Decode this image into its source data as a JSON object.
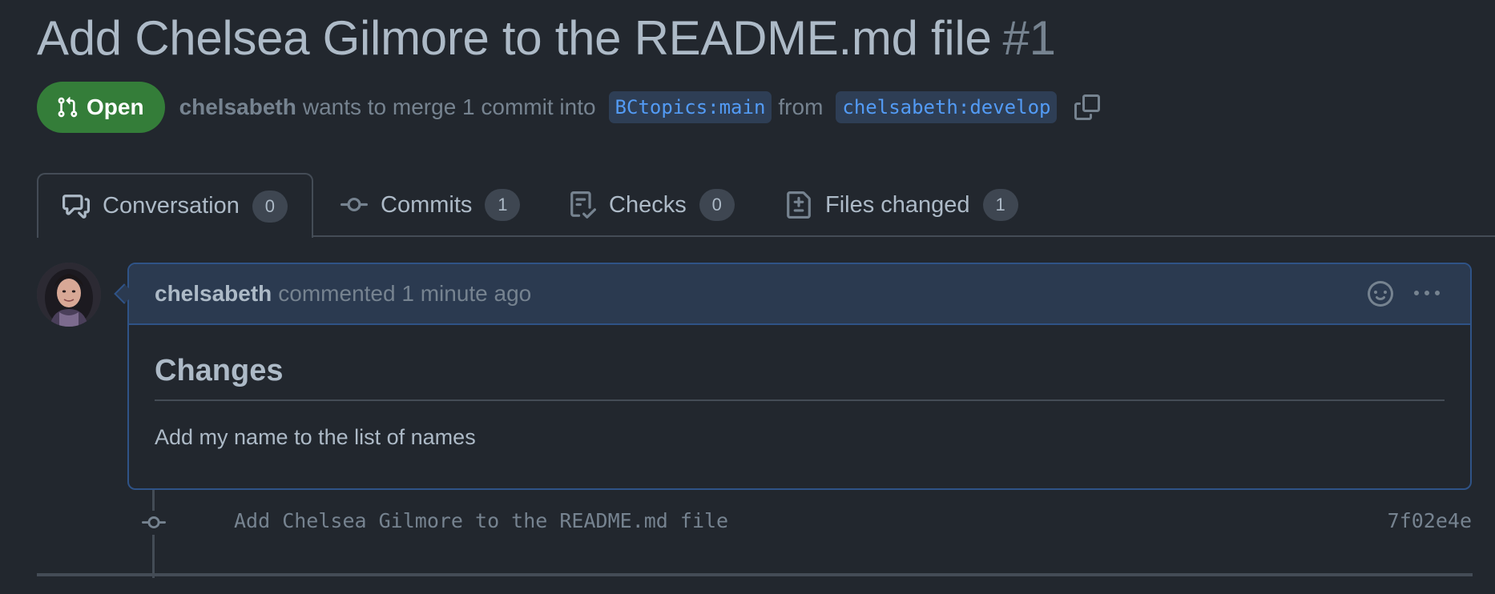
{
  "pr": {
    "title": "Add Chelsea Gilmore to the README.md file",
    "number": "#1",
    "state": "Open",
    "author": "chelsabeth",
    "merge_text": "wants to merge 1 commit into",
    "base_branch": "BCtopics:main",
    "from_text": "from",
    "head_branch": "chelsabeth:develop"
  },
  "tabs": [
    {
      "label": "Conversation",
      "count": "0",
      "icon": "comment-discussion-icon"
    },
    {
      "label": "Commits",
      "count": "1",
      "icon": "git-commit-icon"
    },
    {
      "label": "Checks",
      "count": "0",
      "icon": "checklist-icon"
    },
    {
      "label": "Files changed",
      "count": "1",
      "icon": "file-diff-icon"
    }
  ],
  "comment": {
    "author": "chelsabeth",
    "meta": "commented 1 minute ago",
    "heading": "Changes",
    "body": "Add my name to the list of names"
  },
  "timeline": {
    "commit_message": "Add Chelsea Gilmore to the README.md file",
    "sha": "7f02e4e"
  },
  "colors": {
    "background": "#22272e",
    "open_badge": "#347d39",
    "branch_text": "#539bf5",
    "comment_border": "#2f5387"
  }
}
